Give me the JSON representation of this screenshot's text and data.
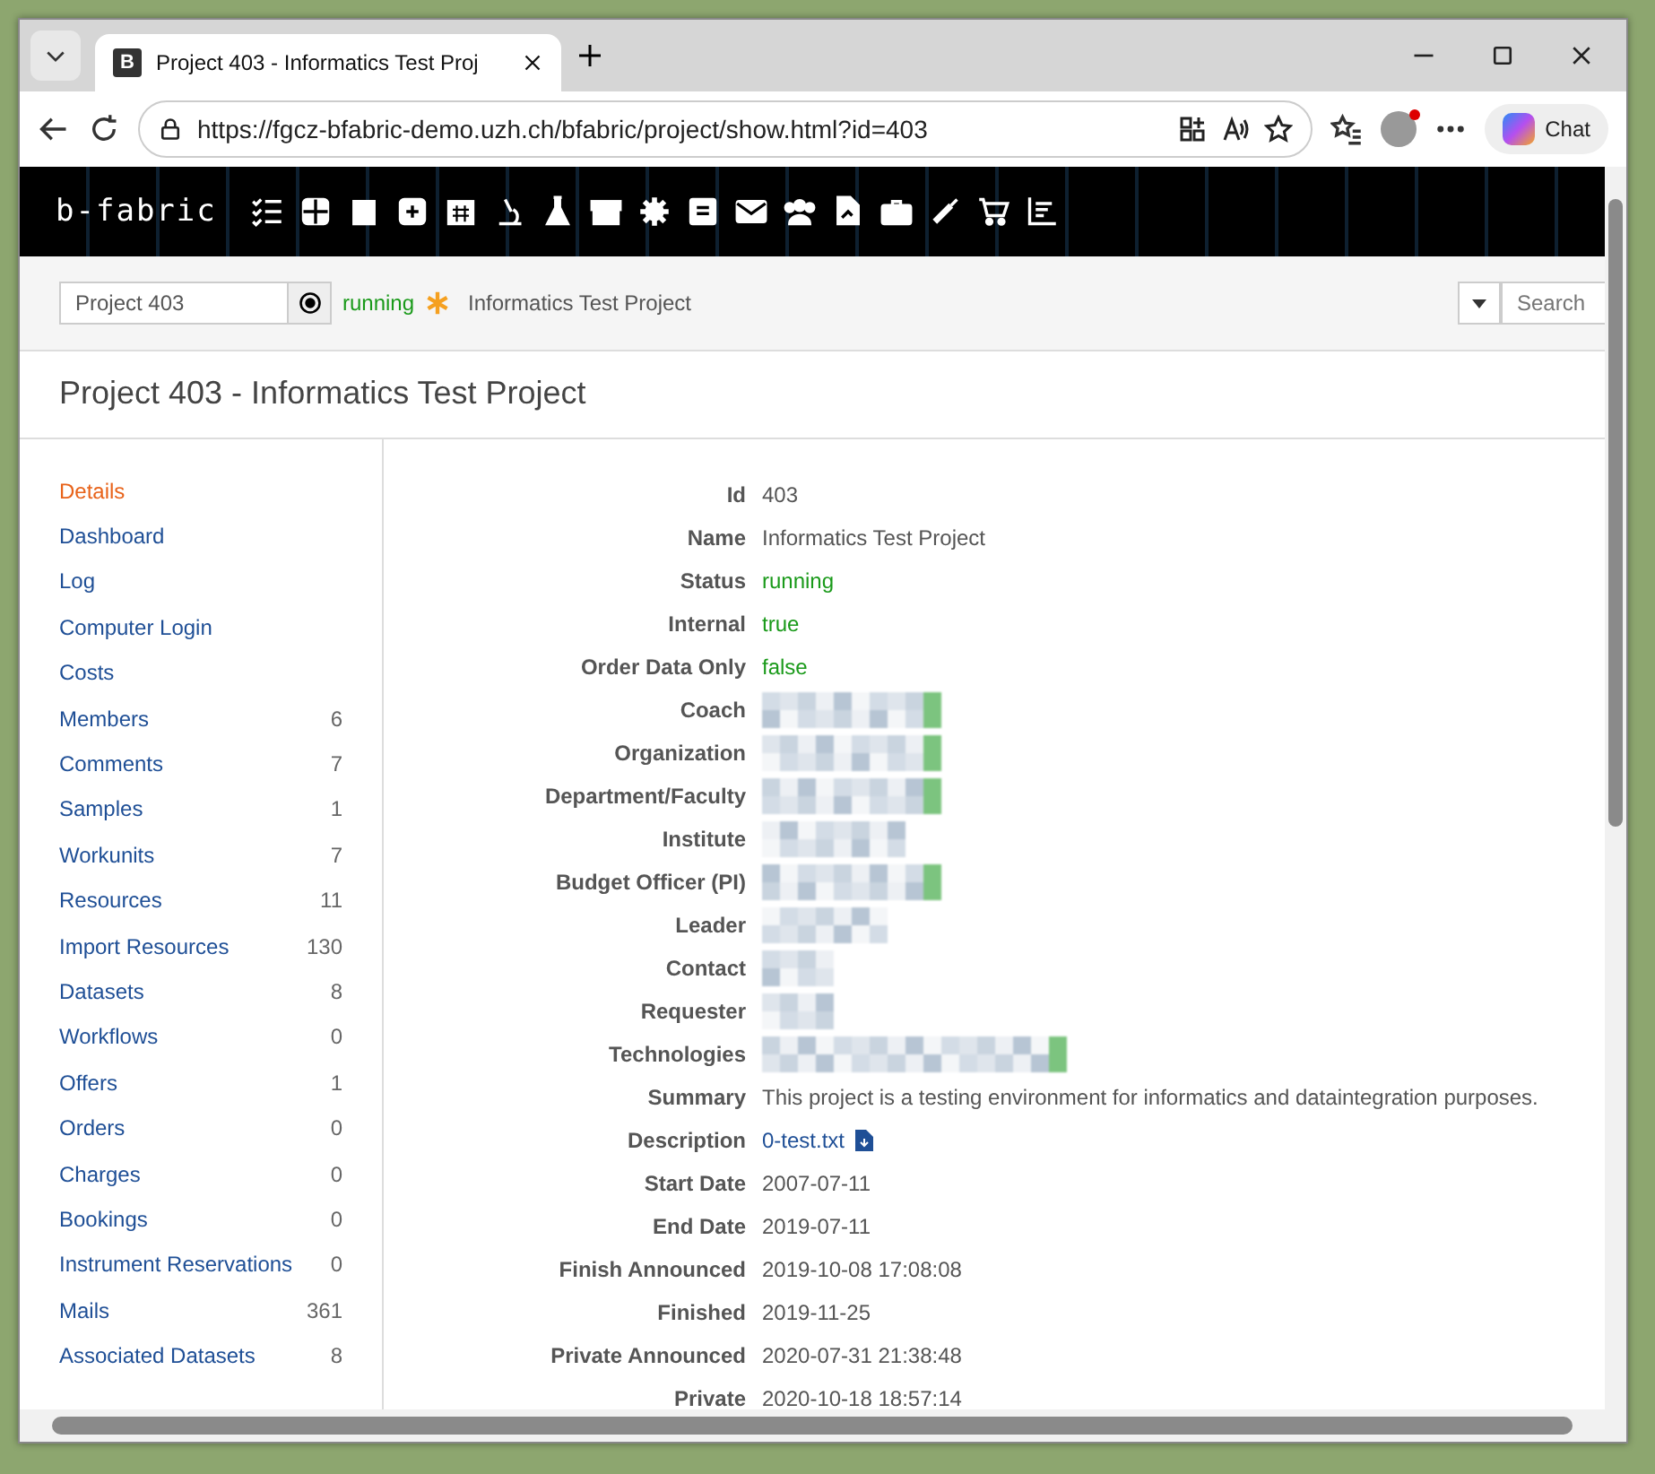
{
  "browser": {
    "favicon_letter": "B",
    "tab_title": "Project 403 - Informatics Test Proj",
    "url": "https://fgcz-bfabric-demo.uzh.ch/bfabric/project/show.html?id=403",
    "chat_label": "Chat"
  },
  "app": {
    "logo": "b-fabric",
    "project_field": {
      "value": "Project 403"
    },
    "status": "running",
    "project_name": "Informatics Test Project",
    "search": {
      "placeholder": "Search"
    }
  },
  "page_title": "Project 403 - Informatics Test Project",
  "sidebar": [
    {
      "label": "Details",
      "selected": true
    },
    {
      "label": "Dashboard",
      "selected": false
    },
    {
      "label": "Log",
      "selected": false
    },
    {
      "label": "Computer Login",
      "selected": false
    },
    {
      "label": "Costs",
      "selected": false
    },
    {
      "label": "Members",
      "count": "6",
      "selected": false
    },
    {
      "label": "Comments",
      "count": "7",
      "selected": false
    },
    {
      "label": "Samples",
      "count": "1",
      "selected": false
    },
    {
      "label": "Workunits",
      "count": "7",
      "selected": false
    },
    {
      "label": "Resources",
      "count": "11",
      "selected": false
    },
    {
      "label": "Import Resources",
      "count": "130",
      "selected": false
    },
    {
      "label": "Datasets",
      "count": "8",
      "selected": false
    },
    {
      "label": "Workflows",
      "count": "0",
      "selected": false
    },
    {
      "label": "Offers",
      "count": "1",
      "selected": false
    },
    {
      "label": "Orders",
      "count": "0",
      "selected": false
    },
    {
      "label": "Charges",
      "count": "0",
      "selected": false
    },
    {
      "label": "Bookings",
      "count": "0",
      "selected": false
    },
    {
      "label": "Instrument Reservations",
      "count": "0",
      "selected": false
    },
    {
      "label": "Mails",
      "count": "361",
      "selected": false
    },
    {
      "label": "Associated Datasets",
      "count": "8",
      "selected": false
    }
  ],
  "details": [
    {
      "label": "Id",
      "kind": "text",
      "value": "403"
    },
    {
      "label": "Name",
      "kind": "text",
      "value": "Informatics Test Project"
    },
    {
      "label": "Status",
      "kind": "status",
      "value": "running"
    },
    {
      "label": "Internal",
      "kind": "status",
      "value": "true"
    },
    {
      "label": "Order Data Only",
      "kind": "status",
      "value": "false"
    },
    {
      "label": "Coach",
      "kind": "redacted"
    },
    {
      "label": "Organization",
      "kind": "redacted"
    },
    {
      "label": "Department/Faculty",
      "kind": "redacted"
    },
    {
      "label": "Institute",
      "kind": "redacted"
    },
    {
      "label": "Budget Officer (PI)",
      "kind": "redacted"
    },
    {
      "label": "Leader",
      "kind": "redacted"
    },
    {
      "label": "Contact",
      "kind": "redacted"
    },
    {
      "label": "Requester",
      "kind": "redacted"
    },
    {
      "label": "Technologies",
      "kind": "redacted"
    },
    {
      "label": "Summary",
      "kind": "text",
      "value": "This project is a testing environment for informatics and dataintegration purposes."
    },
    {
      "label": "Description",
      "kind": "file",
      "value": "0-test.txt"
    },
    {
      "label": "Start Date",
      "kind": "text",
      "value": "2007-07-11"
    },
    {
      "label": "End Date",
      "kind": "text",
      "value": "2019-07-11"
    },
    {
      "label": "Finish Announced",
      "kind": "text",
      "value": "2019-10-08 17:08:08"
    },
    {
      "label": "Finished",
      "kind": "text",
      "value": "2019-11-25"
    },
    {
      "label": "Private Announced",
      "kind": "text",
      "value": "2020-07-31 21:38:48"
    },
    {
      "label": "Private",
      "kind": "text",
      "value": "2020-10-18 18:57:14"
    }
  ]
}
